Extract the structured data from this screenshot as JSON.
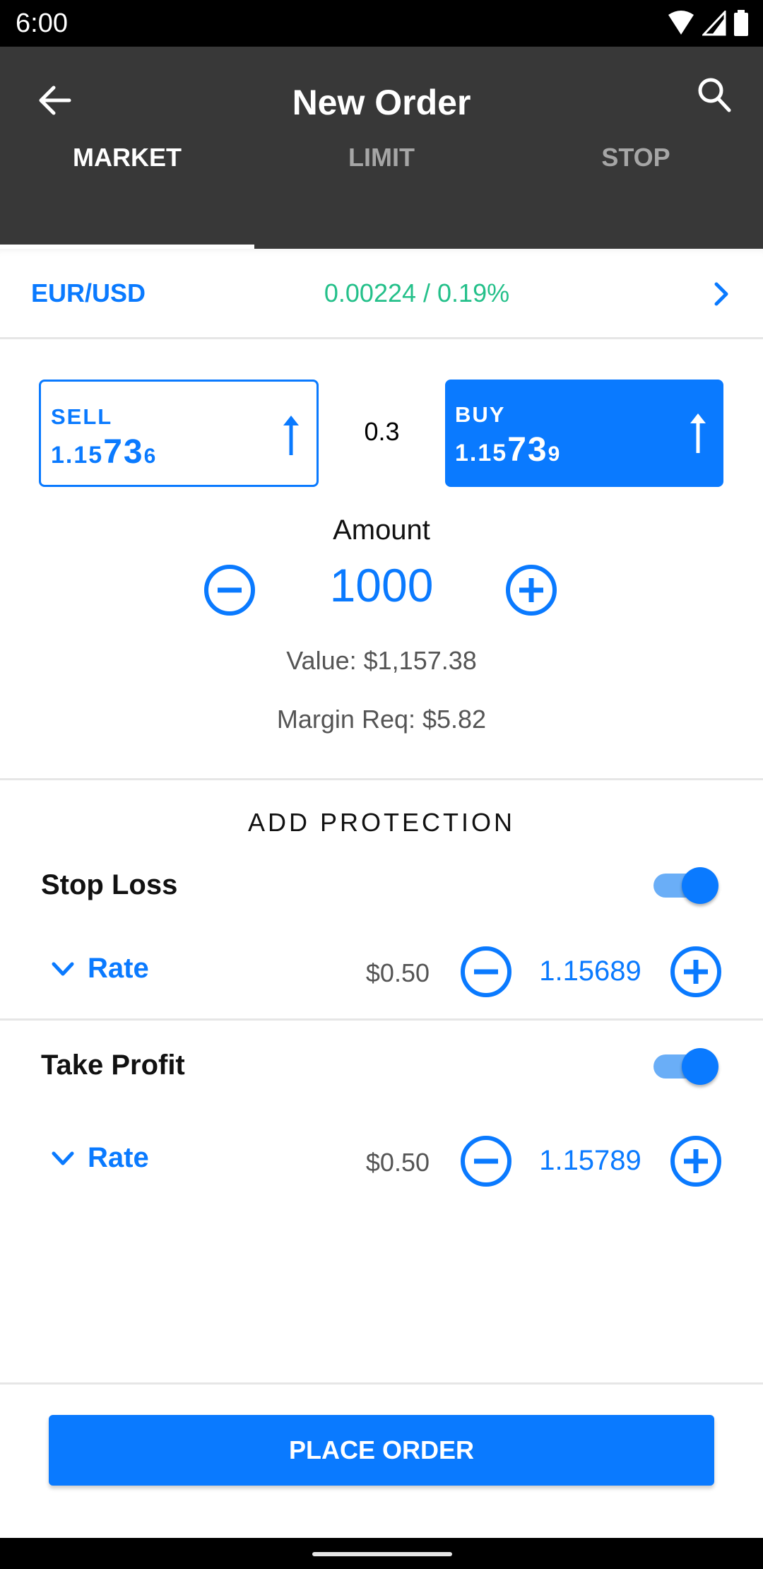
{
  "status_bar": {
    "time": "6:00",
    "icons": [
      "wifi-icon",
      "signal-icon",
      "battery-icon"
    ]
  },
  "header": {
    "title": "New Order",
    "back_icon": "arrow-left-icon",
    "search_icon": "search-icon"
  },
  "tabs": [
    {
      "label": "MARKET",
      "active": true
    },
    {
      "label": "LIMIT",
      "active": false
    },
    {
      "label": "STOP",
      "active": false
    }
  ],
  "instrument": {
    "symbol": "EUR/USD",
    "change": "0.00224 / 0.19%",
    "chevron_icon": "chevron-right-icon"
  },
  "quotes": {
    "sell": {
      "label": "SELL",
      "price_prefix": "1.15",
      "price_pips": "73",
      "price_fraction": "6",
      "direction_icon": "arrow-up-icon"
    },
    "spread": "0.3",
    "buy": {
      "label": "BUY",
      "price_prefix": "1.15",
      "price_pips": "73",
      "price_fraction": "9",
      "direction_icon": "arrow-up-icon"
    }
  },
  "amount": {
    "label": "Amount",
    "value": "1000",
    "value_line": "Value: $1,157.38",
    "margin_line": "Margin Req: $5.82"
  },
  "protection": {
    "title": "ADD PROTECTION",
    "stop_loss": {
      "label": "Stop Loss",
      "enabled": true,
      "rate_label": "Rate",
      "cost": "$0.50",
      "rate": "1.15689"
    },
    "take_profit": {
      "label": "Take Profit",
      "enabled": true,
      "rate_label": "Rate",
      "cost": "$0.50",
      "rate": "1.15789"
    }
  },
  "footer": {
    "place_order_label": "PLACE ORDER"
  },
  "colors": {
    "accent": "#0a7aff",
    "positive": "#24c08a",
    "app_bar": "#383838"
  }
}
